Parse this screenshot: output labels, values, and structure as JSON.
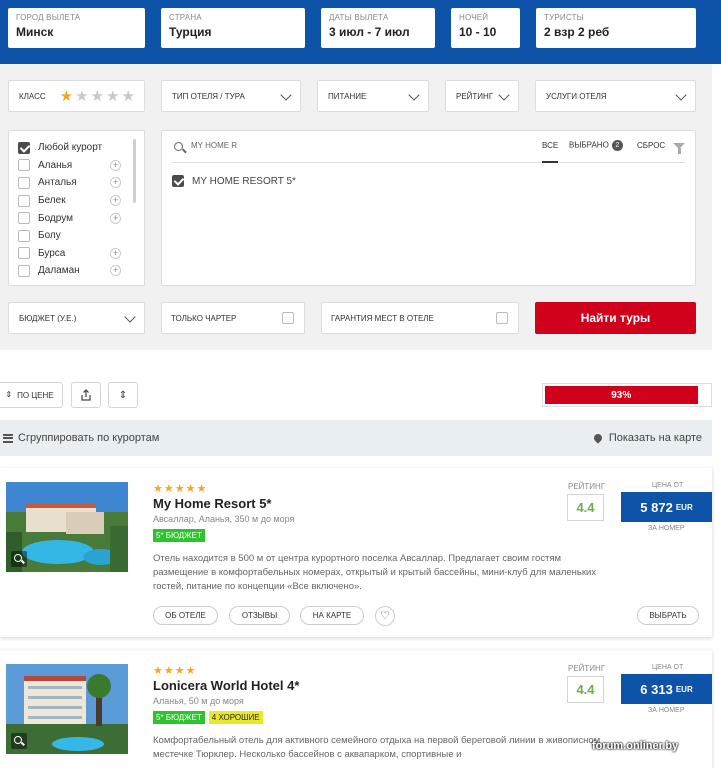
{
  "search": {
    "city": {
      "label": "ГОРОД ВЫЛЕТА",
      "value": "Минск"
    },
    "country": {
      "label": "СТРАНА",
      "value": "Турция"
    },
    "dates": {
      "label": "ДАТЫ ВЫЛЕТА",
      "value": "3 июл - 7 июл"
    },
    "nights": {
      "label": "НОЧЕЙ",
      "value": "10 - 10"
    },
    "tourists": {
      "label": "ТУРИСТЫ",
      "value": "2 взр 2 реб"
    }
  },
  "filters": {
    "class_label": "КЛАСС",
    "class_stars_selected": 1,
    "hotel_type": "ТИП ОТЕЛЯ / ТУРА",
    "meal": "ПИТАНИЕ",
    "rating": "РЕЙТИНГ",
    "services": "УСЛУГИ ОТЕЛЯ",
    "budget": "БЮДЖЕТ (У.Е.)",
    "charter_only": "ТОЛЬКО ЧАРТЕР",
    "guaranteed": "ГАРАНТИЯ МЕСТ В ОТЕЛЕ",
    "find_button": "Найти туры"
  },
  "resorts": [
    {
      "name": "Любой курорт",
      "checked": true,
      "expandable": false
    },
    {
      "name": "Аланья",
      "checked": false,
      "expandable": true
    },
    {
      "name": "Анталья",
      "checked": false,
      "expandable": true
    },
    {
      "name": "Белек",
      "checked": false,
      "expandable": true
    },
    {
      "name": "Бодрум",
      "checked": false,
      "expandable": true
    },
    {
      "name": "Болу",
      "checked": false,
      "expandable": false
    },
    {
      "name": "Бурса",
      "checked": false,
      "expandable": true
    },
    {
      "name": "Даламан",
      "checked": false,
      "expandable": true
    }
  ],
  "hotel_picker": {
    "search_value": "MY HOME R",
    "tab_all": "ВСЕ",
    "tab_selected": "ВЫБРАНО",
    "selected_count": "2",
    "reset": "СБРОС",
    "selected_hotel": "MY HOME RESORT 5*"
  },
  "sort": {
    "price_label": "ПО ЦЕНЕ"
  },
  "progress": {
    "value": 0.93,
    "label": "93%"
  },
  "grouping": {
    "group_label": "Сгруппировать по курортам",
    "map_label": "Показать на карте"
  },
  "card_labels": {
    "rating": "РЕЙТИНГ",
    "price_from": "ЦЕНА ОТ",
    "per_room": "ЗА НОМЕР",
    "about": "ОБ ОТЕЛЕ",
    "reviews": "ОТЗЫВЫ",
    "on_map": "НА КАРТЕ",
    "choose": "ВЫБРАТЬ"
  },
  "hotels": [
    {
      "stars": "★★★★★",
      "name": "My Home Resort 5*",
      "location": "Авсаллар, Аланья, 350 м до моря",
      "tag1": "5* БЮДЖЕТ",
      "tag2": "",
      "description": "Отель находится в 500 м от центра курортного поселка Авсаллар. Предлагает своим гостям размещение в комфортабельных номерах, открытый и крытый бассейны, мини-клуб для маленьких гостей, питание по концепции «Все включено».",
      "rating": "4.4",
      "price": "5 872",
      "currency": "EUR"
    },
    {
      "stars": "★★★★",
      "name": "Lonicera World Hotel 4*",
      "location": "Аланья, 50 м до моря",
      "tag1": "5* БЮДЖЕТ",
      "tag2": "4 ХОРОШИЕ",
      "description": "Комфортабельный отель для активного семейного отдыха на первой береговой линии в живописном местечке Тюрклер. Несколько бассейнов с аквапарком, спортивные и",
      "rating": "4.4",
      "price": "6 313",
      "currency": "EUR"
    }
  ],
  "watermark": "forum.onliner.by",
  "colors": {
    "brand_blue": "#0d53a8",
    "accent_red": "#d0011b",
    "tag_green": "#2cc32c",
    "tag_yellow": "#e9e92a",
    "rating_green": "#6ab04c"
  }
}
